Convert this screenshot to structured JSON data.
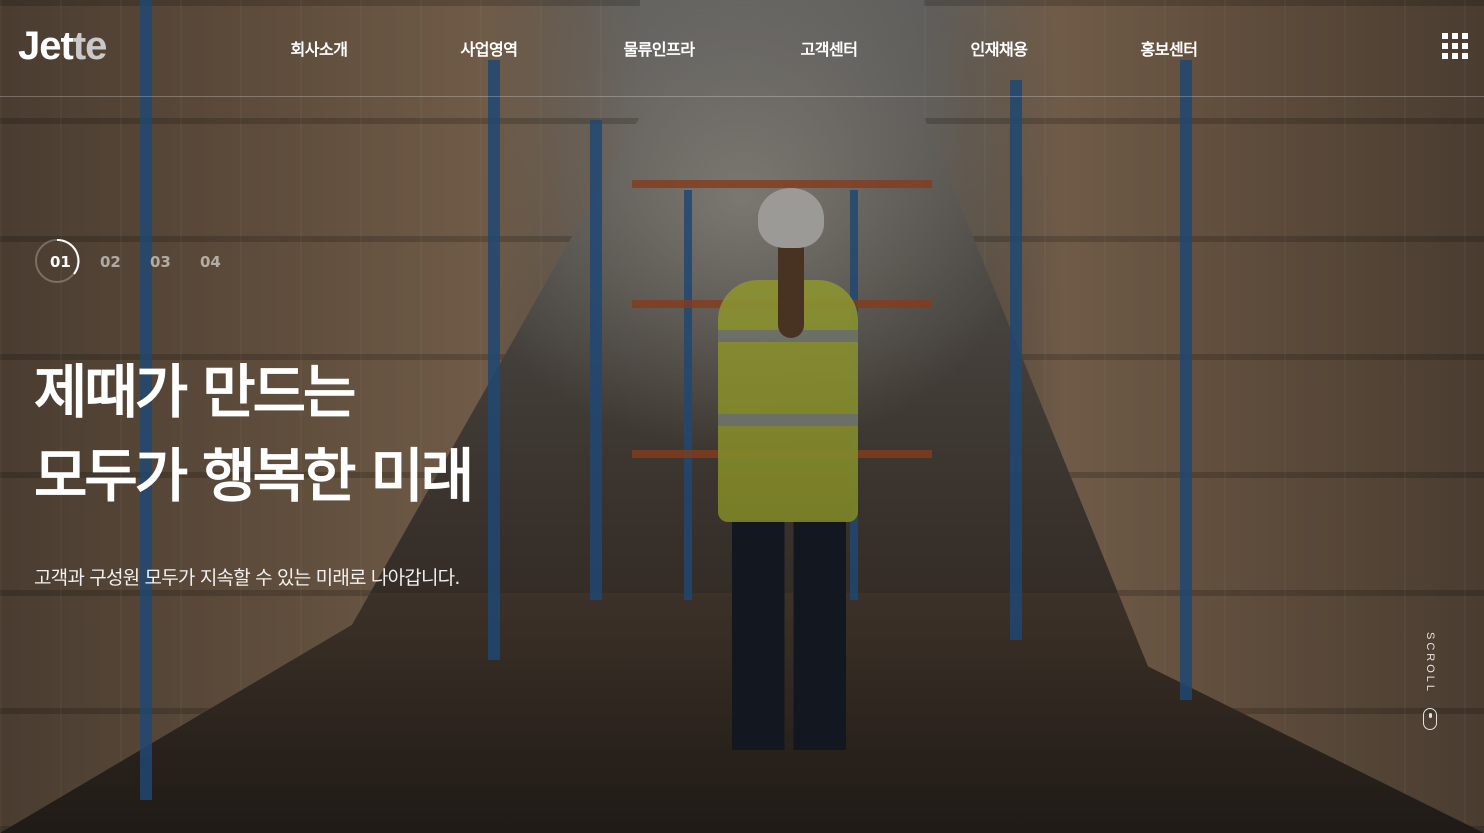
{
  "logo": {
    "part_a": "Jet",
    "part_b": "te"
  },
  "nav": {
    "items": [
      {
        "label": "회사소개"
      },
      {
        "label": "사업영역"
      },
      {
        "label": "물류인프라"
      },
      {
        "label": "고객센터"
      },
      {
        "label": "인재채용"
      },
      {
        "label": "홍보센터"
      }
    ],
    "menu_icon": "grid-menu-icon"
  },
  "slider": {
    "pages": [
      "01",
      "02",
      "03",
      "04"
    ],
    "active_index": 0
  },
  "hero": {
    "headline_line1": "제때가 만드는",
    "headline_line2": "모두가 행복한 미래",
    "subtext": "고객과 구성원 모두가 지속할 수 있는 미래로 나아갑니다."
  },
  "scroll": {
    "label": "SCROLL",
    "icon": "mouse-icon"
  },
  "colors": {
    "text": "#ffffff",
    "logo_secondary": "#c9c9c9"
  }
}
